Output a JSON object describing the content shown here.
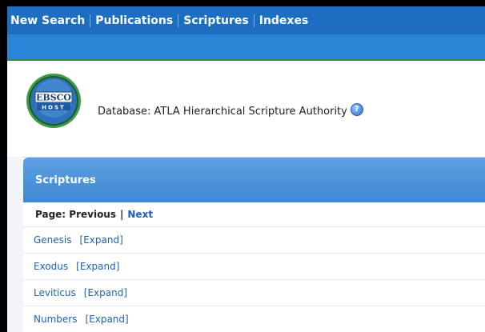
{
  "nav": {
    "items": [
      "New Search",
      "Publications",
      "Scriptures",
      "Indexes"
    ]
  },
  "header": {
    "logo_text_top": "EBSCO",
    "logo_text_bottom": "HOST",
    "database_label": "Database: ATLA Hierarchical Scripture Authority",
    "help_glyph": "?"
  },
  "panel": {
    "title": "Scriptures",
    "pager": {
      "prefix": "Page: Previous",
      "separator": "|",
      "next": "Next"
    },
    "rows": [
      {
        "name": "Genesis",
        "expand": "[Expand]"
      },
      {
        "name": "Exodus",
        "expand": "[Expand]"
      },
      {
        "name": "Leviticus",
        "expand": "[Expand]"
      },
      {
        "name": "Numbers",
        "expand": "[Expand]"
      }
    ]
  },
  "colors": {
    "nav_bg": "#1b6ec2",
    "accent_green": "#2f8f3d",
    "panel_header": "#4a92d8",
    "link": "#1e63b9"
  }
}
